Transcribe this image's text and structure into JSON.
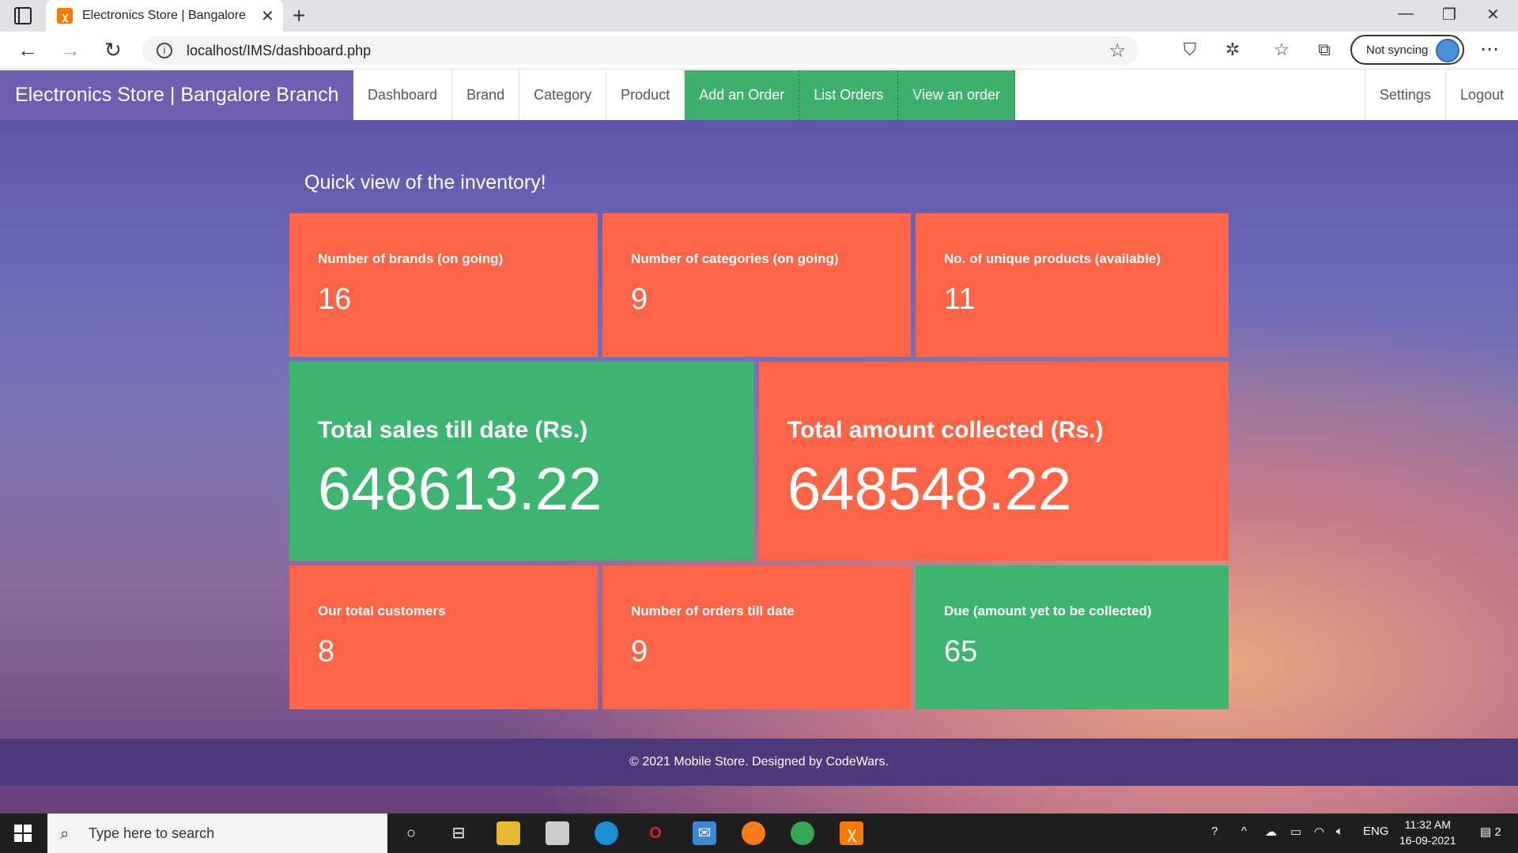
{
  "browser": {
    "tab_title": "Electronics Store | Bangalore Branch",
    "url": "localhost/IMS/dashboard.php",
    "sync_label": "Not syncing"
  },
  "navbar": {
    "brand": "Electronics Store | Bangalore Branch",
    "items": [
      "Dashboard",
      "Brand",
      "Category",
      "Product"
    ],
    "green_items": [
      "Add an Order",
      "List Orders",
      "View an order"
    ],
    "right_items": [
      "Settings",
      "Logout"
    ]
  },
  "main": {
    "heading": "Quick view of the inventory!",
    "row1": [
      {
        "label": "Number of brands (on going)",
        "value": "16"
      },
      {
        "label": "Number of categories (on going)",
        "value": "9"
      },
      {
        "label": "No. of unique products (available)",
        "value": "11"
      }
    ],
    "row2": [
      {
        "label": "Total sales till date (Rs.)",
        "value": "648613.22"
      },
      {
        "label": "Total amount collected (Rs.)",
        "value": "648548.22"
      }
    ],
    "row3": [
      {
        "label": "Our total customers",
        "value": "8"
      },
      {
        "label": "Number of orders till date",
        "value": "9"
      },
      {
        "label": "Due (amount yet to be collected)",
        "value": "65"
      }
    ]
  },
  "footer": {
    "text": "© 2021 Mobile Store. Designed by CodeWars."
  },
  "taskbar": {
    "search_placeholder": "Type here to search",
    "language": "ENG",
    "time": "11:32 AM",
    "date": "16-09-2021",
    "notification_count": "2"
  },
  "colors": {
    "orange": "#fe6446",
    "green": "#3db46f",
    "brand": "#6e5db0"
  }
}
